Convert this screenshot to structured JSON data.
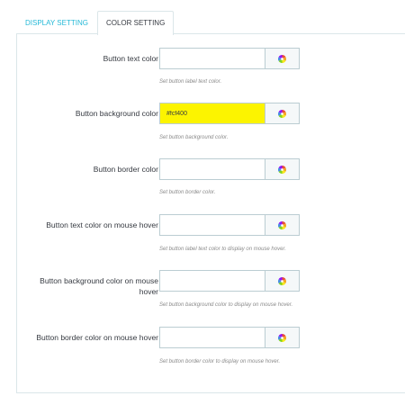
{
  "tabs": [
    {
      "label": "DISPLAY SETTING",
      "active": false
    },
    {
      "label": "COLOR SETTING",
      "active": true
    }
  ],
  "fields": [
    {
      "label": "Button text color",
      "value": "",
      "help": "Set button label text color."
    },
    {
      "label": "Button background color",
      "value": "#fcf400",
      "help": "Set button background color."
    },
    {
      "label": "Button border color",
      "value": "",
      "help": "Set button border color."
    },
    {
      "label": "Button text color on mouse hover",
      "value": "",
      "help": "Set button label text color to display on mouse hover."
    },
    {
      "label": "Button background color on mouse hover",
      "value": "",
      "help": "Set button background color to display on mouse hover."
    },
    {
      "label": "Button border color on mouse hover",
      "value": "",
      "help": "Set button border color to display on mouse hover."
    }
  ],
  "icons": {
    "picker": "color-wheel-icon"
  },
  "colors": {
    "accent": "#25b9d7",
    "highlight": "#fcf400",
    "border": "#bbcdd2"
  }
}
